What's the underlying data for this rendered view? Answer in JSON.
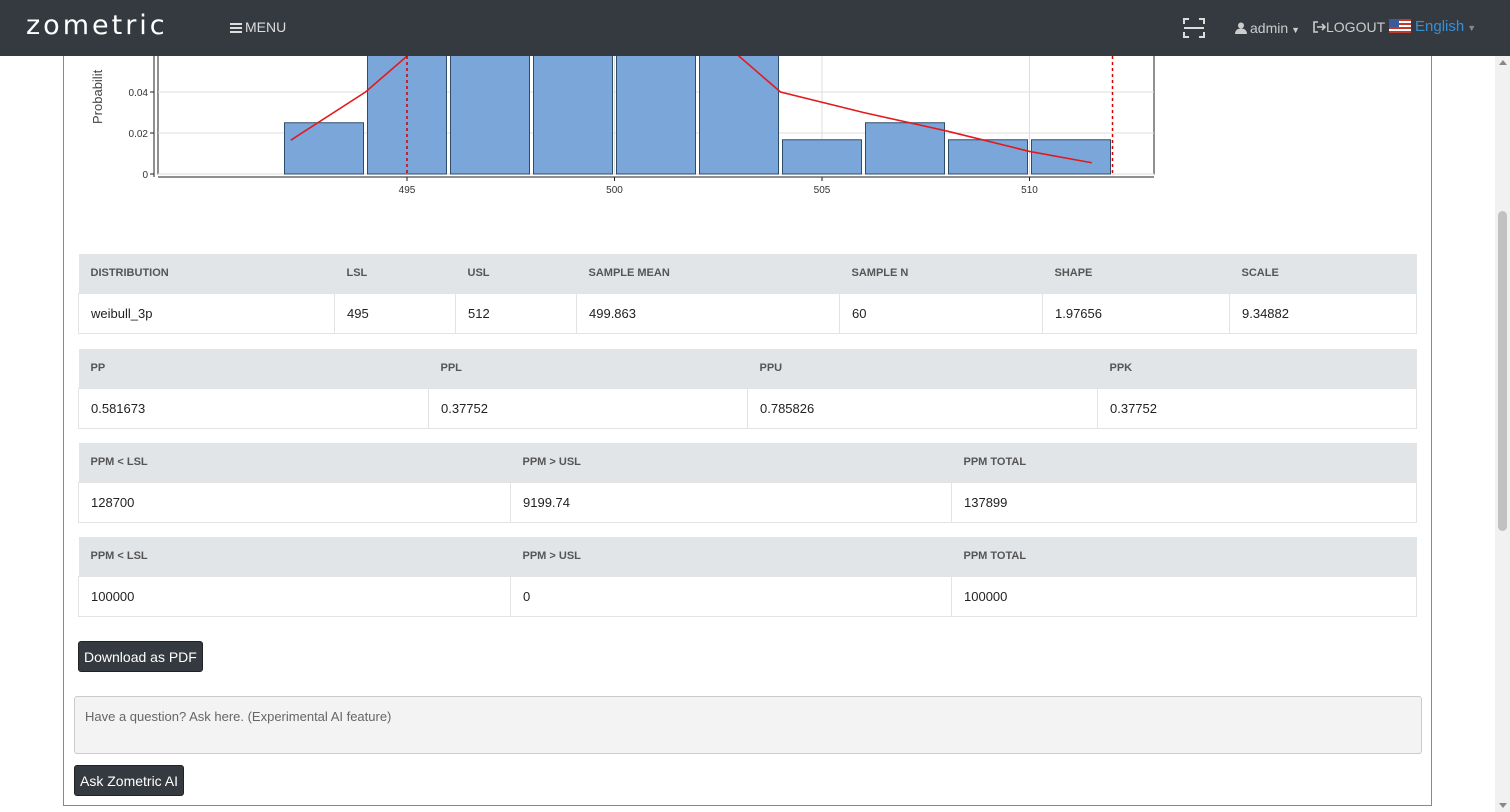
{
  "navbar": {
    "logo": "zometric",
    "menu_label": "MENU",
    "user_label": "admin",
    "logout_label": "LOGOUT",
    "language_label": "English"
  },
  "chart_data": {
    "type": "bar",
    "ylabel": "Probabilit",
    "x_ticks": [
      495,
      500,
      505,
      510
    ],
    "y_ticks": [
      "0",
      "0.02",
      "0.04"
    ],
    "bins": [
      {
        "start": 492,
        "end": 494,
        "density": 0.025
      },
      {
        "start": 494,
        "end": 496,
        "density": 0.1
      },
      {
        "start": 496,
        "end": 498,
        "density": 0.1
      },
      {
        "start": 498,
        "end": 500,
        "density": 0.1
      },
      {
        "start": 500,
        "end": 502,
        "density": 0.1
      },
      {
        "start": 502,
        "end": 504,
        "density": 0.1
      },
      {
        "start": 504,
        "end": 506,
        "density": 0.0167
      },
      {
        "start": 506,
        "end": 508,
        "density": 0.025
      },
      {
        "start": 508,
        "end": 510,
        "density": 0.0167
      },
      {
        "start": 510,
        "end": 512,
        "density": 0.0167
      }
    ],
    "fit_curve": {
      "x": [
        492.2,
        494,
        496,
        502,
        504,
        506,
        508,
        510,
        511.5
      ],
      "y": [
        0.0165,
        0.04,
        0.075,
        0.075,
        0.04,
        0.03,
        0.021,
        0.011,
        0.0055
      ]
    },
    "spec_lines": {
      "lsl": 495,
      "usl": 512
    },
    "xlim": [
      489,
      513
    ],
    "ylim": [
      0,
      0.06
    ],
    "colors": {
      "bar": "#7aa6da",
      "curve": "#e31a1c",
      "spec": "#d00000"
    }
  },
  "tables": [
    {
      "headers": [
        "DISTRIBUTION",
        "LSL",
        "USL",
        "SAMPLE MEAN",
        "SAMPLE N",
        "SHAPE",
        "SCALE"
      ],
      "rows": [
        [
          "weibull_3p",
          "495",
          "512",
          "499.863",
          "60",
          "1.97656",
          "9.34882"
        ]
      ]
    },
    {
      "headers": [
        "PP",
        "PPL",
        "PPU",
        "PPK"
      ],
      "rows": [
        [
          "0.581673",
          "0.37752",
          "0.785826",
          "0.37752"
        ]
      ]
    },
    {
      "headers": [
        "PPM < LSL",
        "PPM > USL",
        "PPM TOTAL"
      ],
      "rows": [
        [
          "128700",
          "9199.74",
          "137899"
        ]
      ]
    },
    {
      "headers": [
        "PPM < LSL",
        "PPM > USL",
        "PPM TOTAL"
      ],
      "rows": [
        [
          "100000",
          "0",
          "100000"
        ]
      ]
    }
  ],
  "actions": {
    "download_pdf": "Download as PDF",
    "ask_placeholder": "Have a question? Ask here. (Experimental AI feature)",
    "ask_button": "Ask Zometric AI"
  }
}
